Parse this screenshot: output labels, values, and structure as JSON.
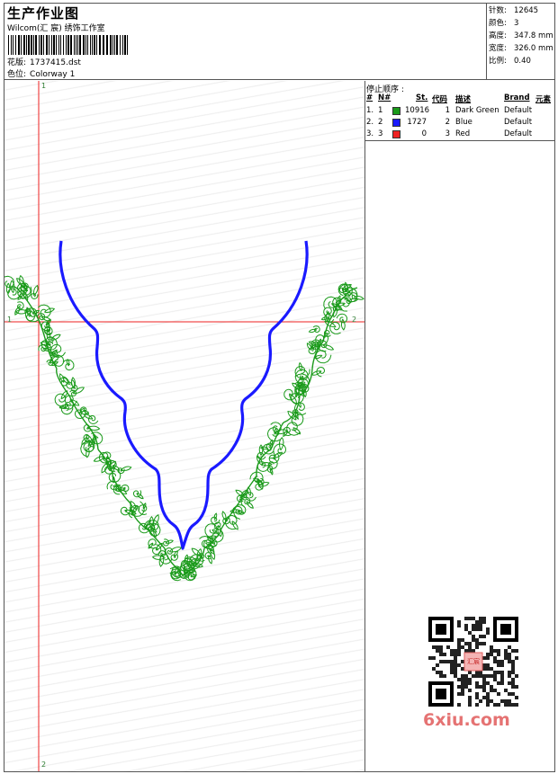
{
  "header": {
    "title": "生产作业图",
    "studio": "Wilcom(汇 宸) 绣饰工作室",
    "design_label": "花版:",
    "design_file": "1737415.dst",
    "colorway_label": "色位:",
    "colorway": "Colorway 1"
  },
  "stats": [
    {
      "key": "针数:",
      "value": "12645"
    },
    {
      "key": "颜色:",
      "value": "3"
    },
    {
      "key": "高度:",
      "value": "347.8 mm"
    },
    {
      "key": "宽度:",
      "value": "326.0 mm"
    },
    {
      "key": "比例:",
      "value": "0.40"
    }
  ],
  "sequence": {
    "title": "停止顺序 :",
    "headers": [
      "#",
      "N#",
      "St.",
      "代码",
      "描述",
      "Brand",
      "元素"
    ],
    "rows": [
      {
        "num": "1.",
        "n": "1",
        "st": "10916",
        "code": "1",
        "desc": "Dark Green",
        "brand": "Default",
        "color": "#1a9a1a"
      },
      {
        "num": "2.",
        "n": "2",
        "st": "1727",
        "code": "2",
        "desc": "Blue",
        "brand": "Default",
        "color": "#1a1aff"
      },
      {
        "num": "3.",
        "n": "3",
        "st": "0",
        "code": "3",
        "desc": "Red",
        "brand": "Default",
        "color": "#ee2222"
      }
    ]
  },
  "canvas": {
    "axis_labels": {
      "top": "1",
      "left": "1",
      "right": "2",
      "bottom": "2"
    },
    "crosshair_color": "#ee2222",
    "outline_color": "#1a1aff",
    "embroidery_color": "#1a9a1a"
  },
  "watermark": {
    "logo_text": "6xiu.com",
    "stamp_text": "汇宸"
  }
}
